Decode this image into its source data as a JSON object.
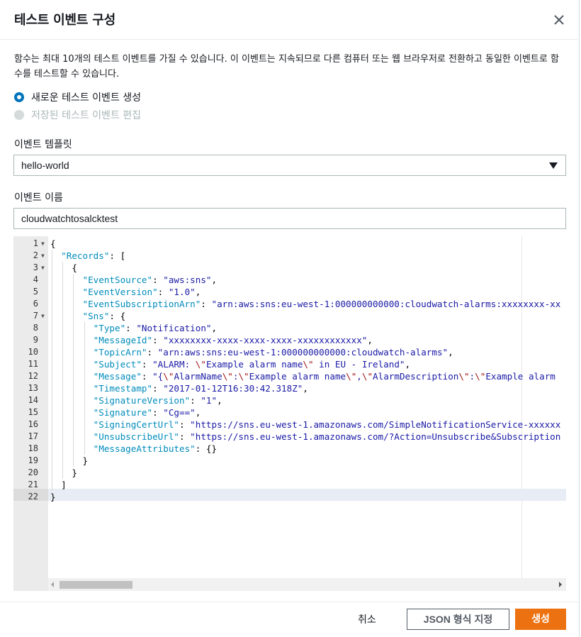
{
  "modal": {
    "title": "테스트 이벤트 구성",
    "close_icon": "close-icon",
    "description": "함수는 최대 10개의 테스트 이벤트를 가질 수 있습니다. 이 이벤트는 지속되므로 다른 컴퓨터 또는 웹 브라우저로 전환하고 동일한 이벤트로 함수를 테스트할 수 있습니다."
  },
  "options": {
    "create_new": {
      "label": "새로운 테스트 이벤트 생성",
      "selected": true
    },
    "edit_saved": {
      "label": "저장된 테스트 이벤트 편집",
      "disabled": true
    }
  },
  "template": {
    "label": "이벤트 템플릿",
    "value": "hello-world",
    "caret_icon": "caret-down-icon"
  },
  "event_name": {
    "label": "이벤트 이름",
    "value": "cloudwatchtosalcktest"
  },
  "editor": {
    "active_line": 22,
    "lines": [
      "{",
      "  \"Records\": [",
      "    {",
      "      \"EventSource\": \"aws:sns\",",
      "      \"EventVersion\": \"1.0\",",
      "      \"EventSubscriptionArn\": \"arn:aws:sns:eu-west-1:000000000000:cloudwatch-alarms:xxxxxxxx-xx",
      "      \"Sns\": {",
      "        \"Type\": \"Notification\",",
      "        \"MessageId\": \"xxxxxxxx-xxxx-xxxx-xxxx-xxxxxxxxxxxx\",",
      "        \"TopicArn\": \"arn:aws:sns:eu-west-1:000000000000:cloudwatch-alarms\",",
      "        \"Subject\": \"ALARM: \\\"Example alarm name\\\" in EU - Ireland\",",
      "        \"Message\": \"{\\\"AlarmName\\\":\\\"Example alarm name\\\",\\\"AlarmDescription\\\":\\\"Example alarm",
      "        \"Timestamp\": \"2017-01-12T16:30:42.318Z\",",
      "        \"SignatureVersion\": \"1\",",
      "        \"Signature\": \"Cg==\",",
      "        \"SigningCertUrl\": \"https://sns.eu-west-1.amazonaws.com/SimpleNotificationService-xxxxxx",
      "        \"UnsubscribeUrl\": \"https://sns.eu-west-1.amazonaws.com/?Action=Unsubscribe&Subscription",
      "        \"MessageAttributes\": {}",
      "      }",
      "    }",
      "  ]",
      "}"
    ],
    "fold_lines": [
      1,
      2,
      3,
      7
    ]
  },
  "footer": {
    "cancel_label": "취소",
    "format_label": "JSON 형식 지정",
    "create_label": "생성"
  },
  "colors": {
    "primary": "#ec7211",
    "radio_selected": "#0073bb",
    "json_key": "#008cbb",
    "json_string": "#1a1aa6"
  }
}
